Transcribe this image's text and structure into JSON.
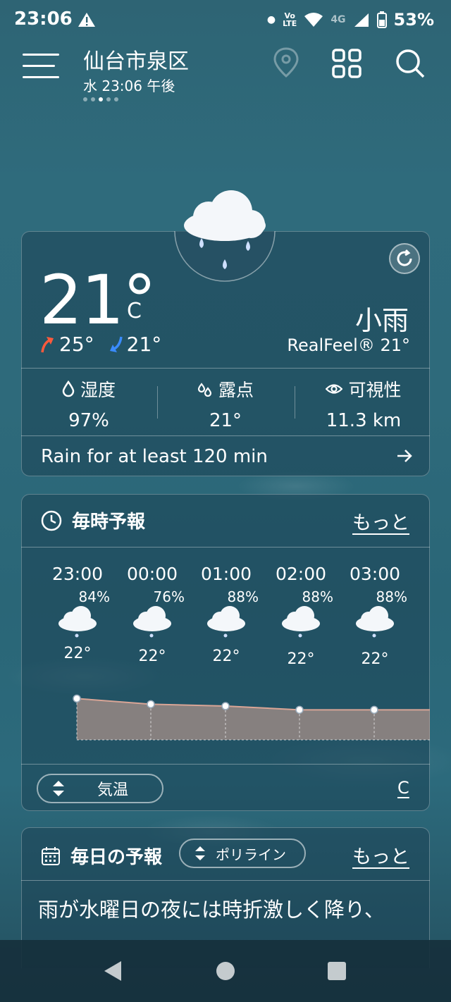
{
  "status": {
    "time": "23:06",
    "battery": "53%",
    "network": "4G"
  },
  "header": {
    "city": "仙台市泉区",
    "subtime": "水 23:06 午後"
  },
  "current": {
    "temp": "21°",
    "unit": "C",
    "high": "25°",
    "low": "21°",
    "condition": "小雨",
    "realfeel": "RealFeel® 21°",
    "stats": [
      {
        "label": "湿度",
        "value": "97%"
      },
      {
        "label": "露点",
        "value": "21°"
      },
      {
        "label": "可視性",
        "value": "11.3 km"
      }
    ],
    "rain_note": "Rain for at least 120 min"
  },
  "hourly": {
    "title": "毎時予報",
    "more": "もっと",
    "hours": [
      {
        "time": "23:00",
        "precip": "84%",
        "temp": "22°",
        "value": 22.2
      },
      {
        "time": "00:00",
        "precip": "76%",
        "temp": "22°",
        "value": 21.9
      },
      {
        "time": "01:00",
        "precip": "88%",
        "temp": "22°",
        "value": 21.8
      },
      {
        "time": "02:00",
        "precip": "88%",
        "temp": "22°",
        "value": 21.6
      },
      {
        "time": "03:00",
        "precip": "88%",
        "temp": "22°",
        "value": 21.6
      }
    ],
    "metric_label": "気温",
    "unit_label": "C"
  },
  "daily": {
    "title": "毎日の予報",
    "mode_label": "ポリライン",
    "more": "もっと",
    "text": "雨が水曜日の夜には時折激しく降り、"
  },
  "colors": {
    "accent_up": "#ff5a3c",
    "accent_down": "#3a8cff",
    "chart_fill": "#d9a596"
  }
}
